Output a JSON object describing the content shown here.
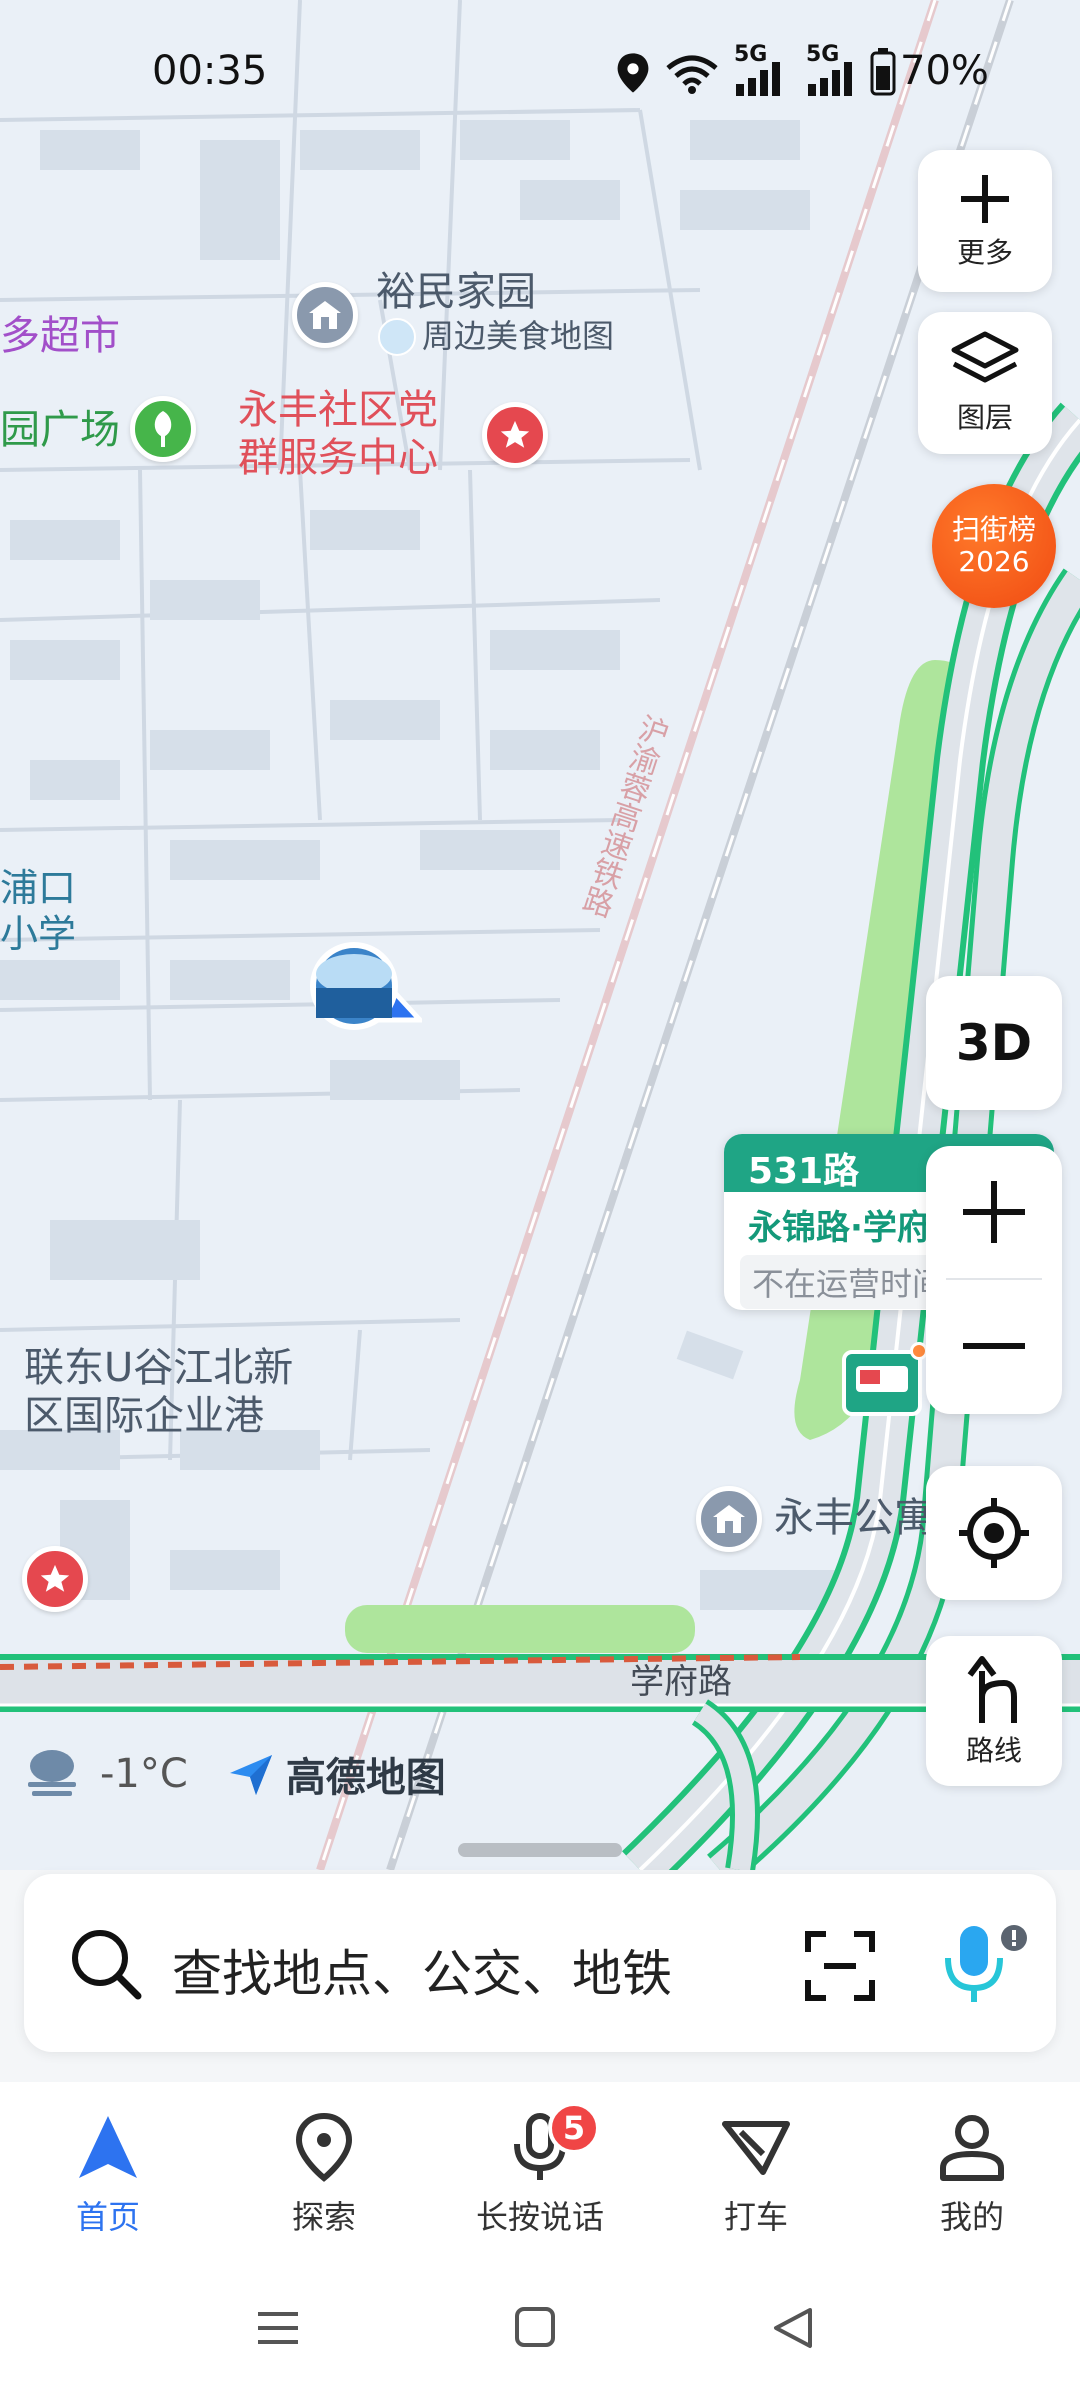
{
  "status_bar": {
    "time": "00:35",
    "battery_percent": "70%",
    "network_1": "5G",
    "network_2": "5G",
    "icons": [
      "location-icon",
      "wifi-icon",
      "signal-icon",
      "signal-icon",
      "battery-icon"
    ]
  },
  "map": {
    "labels": {
      "supermarket": "多超市",
      "plaza": "园广场",
      "residence": "裕民家园",
      "food_map": "周边美食地图",
      "party_center_line1": "永丰社区党",
      "party_center_line2": "群服务中心",
      "railway": "沪渝蓉高速铁路",
      "school_line1": "浦口",
      "school_line2": "小学",
      "business_line1": "联东U谷江北新",
      "business_line2": "区国际企业港",
      "apartment": "永丰公寓",
      "road": "学府路"
    },
    "bus_card": {
      "route": "531路",
      "stop": "永锦路·学府路",
      "status": "不在运营时间"
    },
    "scan_badge": {
      "line1": "扫街榜",
      "line2": "2026"
    },
    "weather": {
      "temp": "-1°C",
      "brand": "高德地图"
    }
  },
  "controls": {
    "more_label": "更多",
    "layers_label": "图层",
    "view_3d": "3D",
    "route_label": "路线"
  },
  "search": {
    "placeholder": "查找地点、公交、地铁"
  },
  "tabs": [
    {
      "label": "首页",
      "icon": "navigation-arrow-icon",
      "active": true
    },
    {
      "label": "探索",
      "icon": "location-pin-icon",
      "active": false
    },
    {
      "label": "长按说话",
      "icon": "microphone-icon",
      "badge": "5",
      "active": false
    },
    {
      "label": "打车",
      "icon": "taxi-flag-icon",
      "active": false
    },
    {
      "label": "我的",
      "icon": "person-icon",
      "active": false
    }
  ],
  "colors": {
    "accent": "#2d73f0",
    "road_green": "#22c17a",
    "poi_red": "#e0505a"
  }
}
